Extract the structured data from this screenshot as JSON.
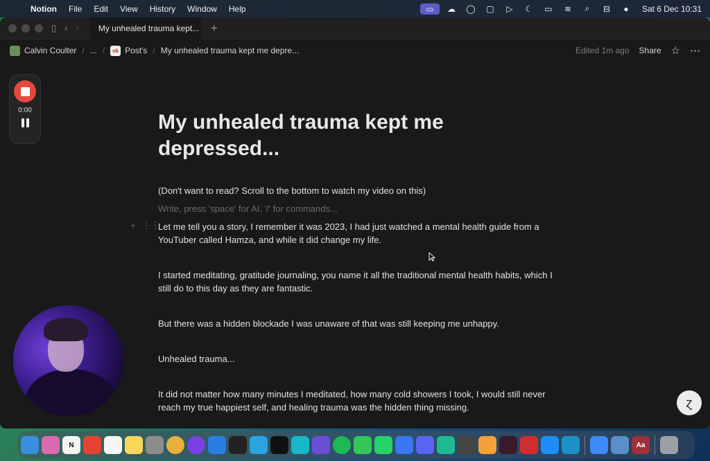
{
  "menubar": {
    "app_name": "Notion",
    "menus": [
      "File",
      "Edit",
      "View",
      "History",
      "Window",
      "Help"
    ],
    "datetime": "Sat 6 Dec  10:31"
  },
  "tab": {
    "title": "My unhealed trauma kept..."
  },
  "breadcrumb": {
    "workspace": "Calvin Coulter",
    "ellipsis": "...",
    "parent_icon_text": "sk",
    "parent": "Post's",
    "page": "My unhealed trauma kept me depre..."
  },
  "topbar": {
    "edited": "Edited 1m ago",
    "share_label": "Share"
  },
  "recorder": {
    "time": "0:00"
  },
  "page": {
    "title": "My unhealed trauma kept me depressed...",
    "paragraphs": [
      "(Don't want to read? Scroll to the bottom to watch my video on this)",
      "Write, press 'space' for AI, '/' for commands...",
      "Let me tell you a story, I remember it was 2023, I had just watched a mental health guide from a YouTuber called Hamza, and while it did change my life.",
      "I started meditating, gratitude journaling, you name it all the traditional mental health habits, which I still do to this day as they are fantastic.",
      "But there was a hidden blockade I was unaware of that was still keeping me unhappy.",
      "Unhealed trauma...",
      "It did not matter how many minutes I meditated, how many cold showers I took, I would still never reach my true happiest self, and healing trauma was the hidden thing missing."
    ]
  },
  "colors": {
    "accent": "#e5483f",
    "background": "#191919"
  },
  "dock": {
    "apps": [
      "finder-icon",
      "launchpad-icon",
      "notion-icon",
      "todoist-icon",
      "reminders-icon",
      "notes-icon",
      "settings-icon",
      "chrome-icon",
      "arc-icon",
      "safari-icon",
      "capcut-icon",
      "telegram-icon",
      "capcut-alt-icon",
      "canva-icon",
      "proton-icon",
      "spotify-icon",
      "messages-icon",
      "whatsapp-icon",
      "signal-icon",
      "discord-icon",
      "feather-icon",
      "cloud-icon",
      "photos-icon",
      "app-icon",
      "raycast-icon",
      "appstore-icon",
      "screen-icon",
      "mail-icon",
      "preview-icon",
      "dictionary-icon",
      "trash-icon"
    ],
    "dictionary_label": "Aa"
  }
}
